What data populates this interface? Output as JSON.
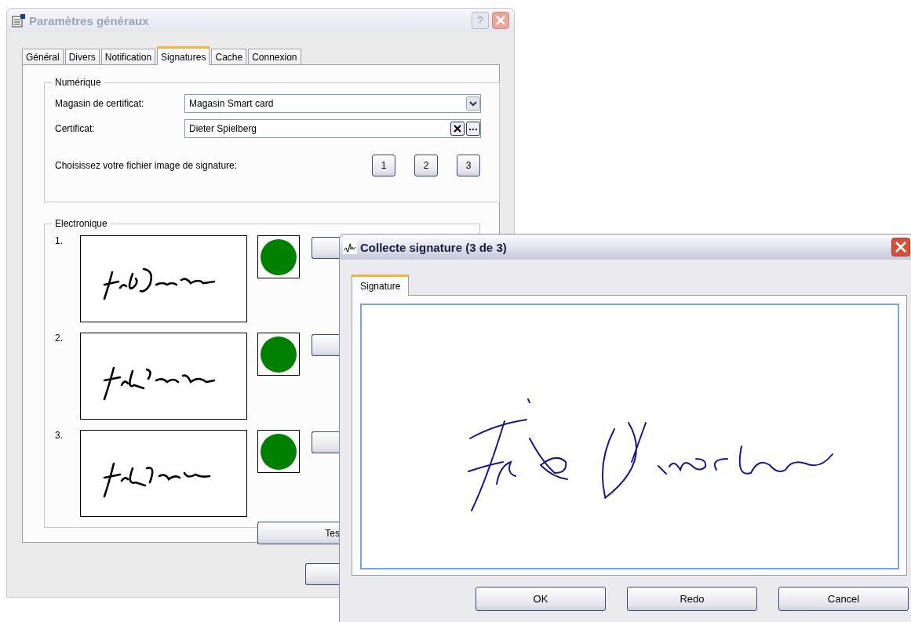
{
  "settings_window": {
    "title": "Paramètres généraux",
    "help_button": "?",
    "tabs": [
      {
        "label": "Général",
        "selected": false
      },
      {
        "label": "Divers",
        "selected": false
      },
      {
        "label": "Notification",
        "selected": false
      },
      {
        "label": "Signatures",
        "selected": true
      },
      {
        "label": "Cache",
        "selected": false
      },
      {
        "label": "Connexion",
        "selected": false
      }
    ],
    "digital_group": {
      "title": "Numérique",
      "store_label": "Magasin de certificat:",
      "store_value": "Magasin Smart card",
      "certificate_label": "Certificat:",
      "certificate_value": "Dieter Spielberg",
      "image_prompt": "Choisissez votre fichier image de signature:",
      "image_buttons": [
        "1",
        "2",
        "3"
      ]
    },
    "electronic_group": {
      "title": "Electronique",
      "signatures": [
        {
          "number": "1.",
          "color": "#008000"
        },
        {
          "number": "2.",
          "color": "#008000"
        },
        {
          "number": "3.",
          "color": "#008000"
        }
      ],
      "test_button": "Tes"
    }
  },
  "capture_window": {
    "title": "Collecte signature (3 de 3)",
    "tabs": [
      {
        "label": "Signature",
        "selected": true
      }
    ],
    "buttons": [
      "OK",
      "Redo",
      "Cancel"
    ]
  }
}
